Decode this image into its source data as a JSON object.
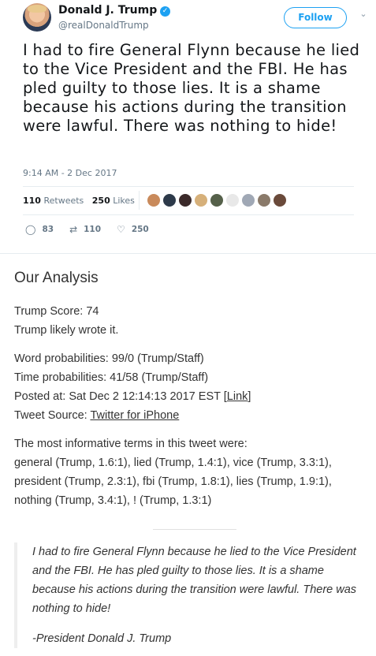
{
  "tweet": {
    "author": {
      "name": "Donald J. Trump",
      "handle": "@realDonaldTrump",
      "verified_icon": "verified-badge-icon"
    },
    "follow_label": "Follow",
    "text": "I had to fire General Flynn because he lied to the Vice President and the FBI. He has pled guilty to those lies. It is a shame because his actions during the transition were lawful. There was nothing to hide!",
    "timestamp": "9:14 AM - 2 Dec 2017",
    "retweets_count": "110",
    "retweets_label": "Retweets",
    "likes_count": "250",
    "likes_label": "Likes",
    "actions": {
      "reply": "83",
      "retweet": "110",
      "like": "250"
    },
    "colors": {
      "accent": "#1da1f2",
      "muted": "#657786"
    }
  },
  "analysis": {
    "title": "Our Analysis",
    "trump_score": "Trump Score: 74",
    "likely": "Trump likely wrote it.",
    "word_prob": "Word probabilities: 99/0 (Trump/Staff)",
    "time_prob": "Time probabilities: 41/58 (Trump/Staff)",
    "posted_prefix": "Posted at: Sat Dec 2 12:14:13 2017 EST [",
    "posted_link": "Link",
    "posted_suffix": "]",
    "source_prefix": "Tweet Source: ",
    "source_link": "Twitter for iPhone",
    "terms_intro": "The most informative terms in this tweet were:",
    "terms": "general (Trump, 1.6:1), lied (Trump, 1.4:1), vice (Trump, 3.3:1), president (Trump, 2.3:1), fbi (Trump, 1.8:1), lies (Trump, 1.9:1), nothing (Trump, 3.4:1), ! (Trump, 1.3:1)"
  },
  "quote": {
    "text": "I had to fire General Flynn because he lied to the Vice President and the FBI. He has pled guilty to those lies. It is a shame because his actions during the transition were lawful. There was nothing to hide!",
    "signature": "-President Donald J. Trump"
  }
}
